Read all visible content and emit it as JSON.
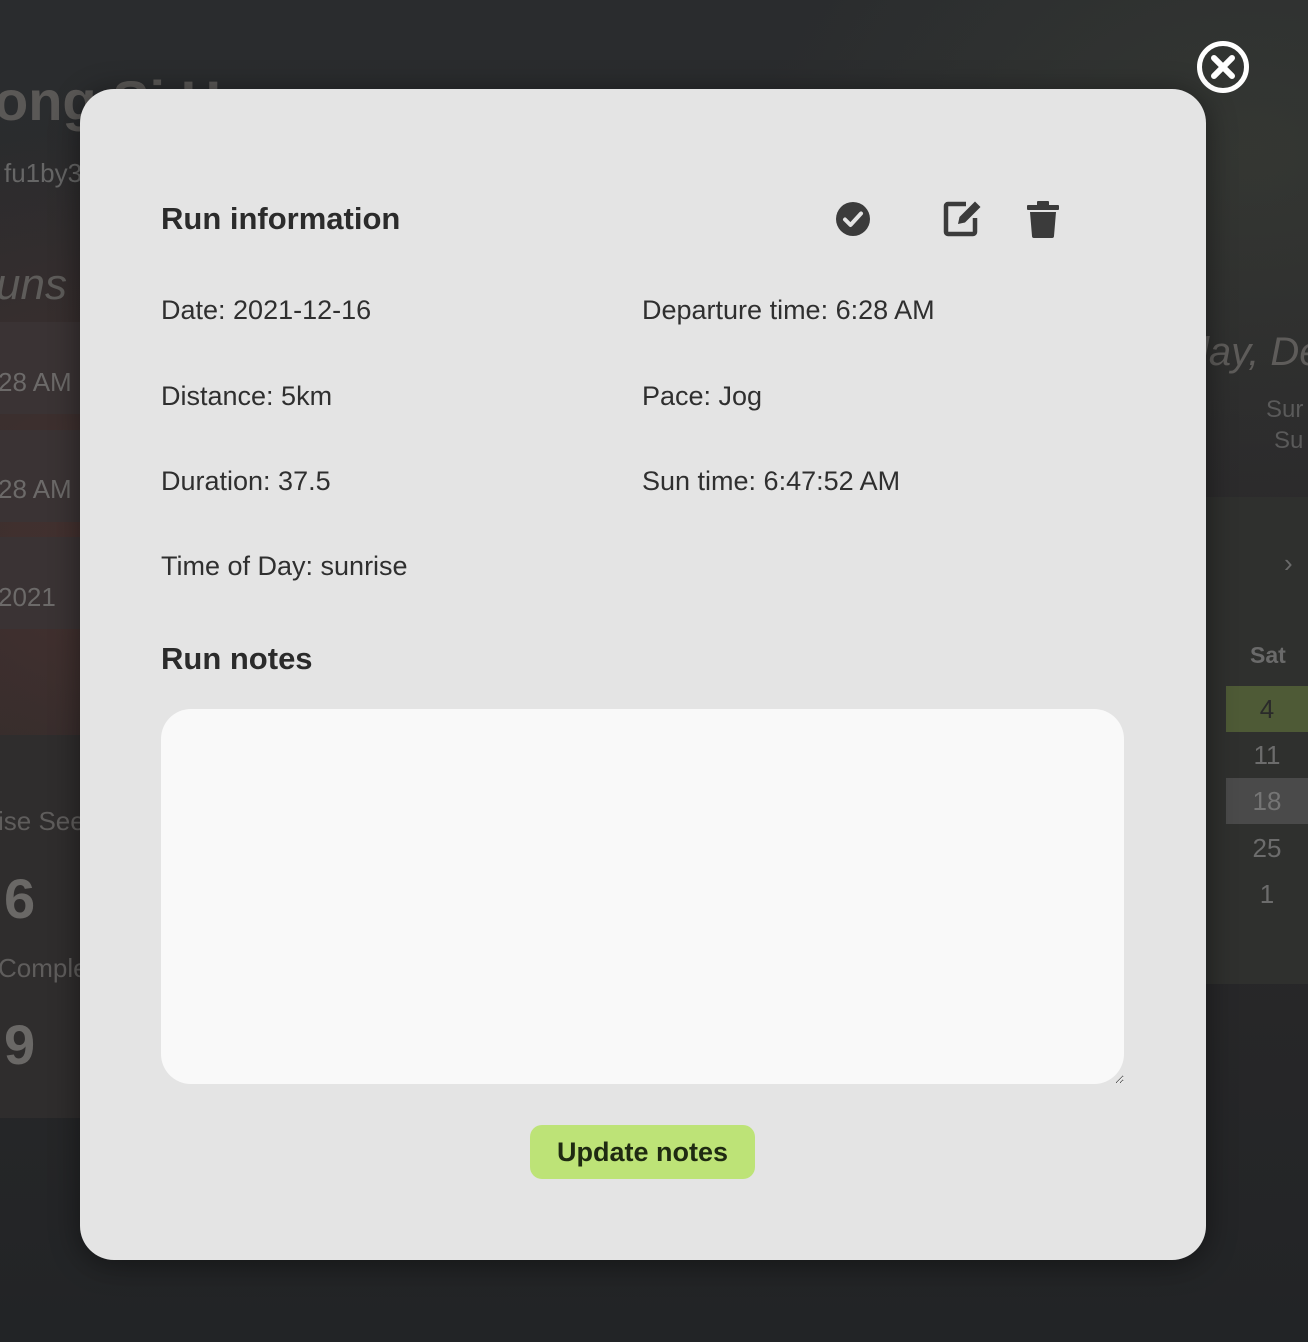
{
  "background": {
    "profile_name": "ong Si H",
    "username": "fu1by3",
    "runs_heading": "uns",
    "run_rows": [
      "28 AM",
      "28 AM",
      "2021"
    ],
    "stats": [
      {
        "label": "ise See",
        "value": "6"
      },
      {
        "label": "Comple",
        "value": "9"
      }
    ],
    "date_heading": "lay, De",
    "sun_lines": [
      "Sur",
      "Su"
    ],
    "calendar": {
      "next_icon": "chevron-right-icon",
      "next_glyph": "›",
      "weekday": "Sat",
      "days": [
        "4",
        "11",
        "18",
        "25",
        "1"
      ]
    }
  },
  "modal": {
    "close_icon": "close-circle-icon",
    "run_info_title": "Run information",
    "actions": {
      "complete_icon": "check-circle-icon",
      "edit_icon": "edit-icon",
      "delete_icon": "trash-icon"
    },
    "fields": {
      "date": "Date: 2021-12-16",
      "departure": "Departure time: 6:28 AM",
      "distance": "Distance: 5km",
      "pace": "Pace: Jog",
      "duration": "Duration: 37.5",
      "sun_time": "Sun time: 6:47:52 AM",
      "time_of_day": "Time of Day: sunrise"
    },
    "notes_title": "Run notes",
    "notes_value": "",
    "update_button": "Update notes"
  },
  "colors": {
    "modal_bg": "#e4e4e4",
    "accent_button": "#bde377",
    "overlay_bg": "#222426"
  }
}
